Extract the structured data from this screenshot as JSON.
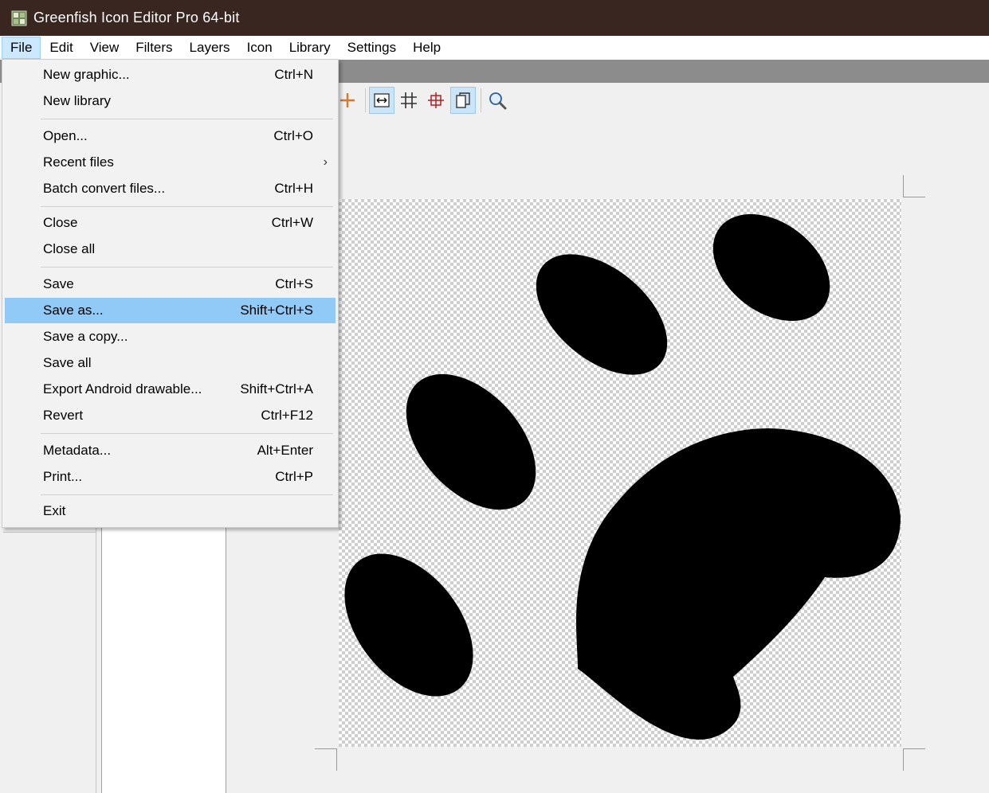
{
  "window": {
    "title": "Greenfish Icon Editor Pro 64-bit"
  },
  "menubar": {
    "items": [
      {
        "label": "File"
      },
      {
        "label": "Edit"
      },
      {
        "label": "View"
      },
      {
        "label": "Filters"
      },
      {
        "label": "Layers"
      },
      {
        "label": "Icon"
      },
      {
        "label": "Library"
      },
      {
        "label": "Settings"
      },
      {
        "label": "Help"
      }
    ],
    "open_menu": "File"
  },
  "file_menu": {
    "items": [
      {
        "label": "New graphic...",
        "shortcut": "Ctrl+N"
      },
      {
        "label": "New library",
        "shortcut": ""
      },
      {
        "label": "Open...",
        "shortcut": "Ctrl+O"
      },
      {
        "label": "Recent files",
        "shortcut": "",
        "submenu_arrow": "›"
      },
      {
        "label": "Batch convert files...",
        "shortcut": "Ctrl+H"
      },
      {
        "label": "Close",
        "shortcut": "Ctrl+W"
      },
      {
        "label": "Close all",
        "shortcut": ""
      },
      {
        "label": "Save",
        "shortcut": "Ctrl+S"
      },
      {
        "label": "Save as...",
        "shortcut": "Shift+Ctrl+S",
        "highlighted": true
      },
      {
        "label": "Save a copy...",
        "shortcut": ""
      },
      {
        "label": "Save all",
        "shortcut": ""
      },
      {
        "label": "Export Android drawable...",
        "shortcut": "Shift+Ctrl+A"
      },
      {
        "label": "Revert",
        "shortcut": "Ctrl+F12"
      },
      {
        "label": "Metadata...",
        "shortcut": "Alt+Enter"
      },
      {
        "label": "Print...",
        "shortcut": "Ctrl+P"
      },
      {
        "label": "Exit",
        "shortcut": ""
      }
    ]
  },
  "toolbar": {
    "icons": [
      "add-icon",
      "fit-width-icon",
      "grid-icon",
      "crosshair-icon",
      "pages-icon",
      "zoom-icon"
    ]
  },
  "colors": {
    "titlebar": "#3a2620",
    "menu_highlight": "#91c9f7",
    "menubar_open": "#cce8ff",
    "canvas_shape": "#000000"
  }
}
